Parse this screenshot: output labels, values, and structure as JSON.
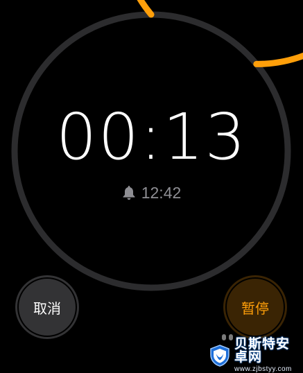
{
  "timer": {
    "remaining": "00:13",
    "alarm_time": "12:42",
    "progress_remaining": 0.86,
    "accent_color": "#ff9f0a",
    "track_color": "#2c2c2e"
  },
  "controls": {
    "cancel_label": "取消",
    "pause_label": "暂停"
  },
  "icons": {
    "alarm": "bell-icon"
  },
  "watermark": {
    "title": "贝斯特安卓网",
    "url": "www.zjbstyy.com"
  }
}
